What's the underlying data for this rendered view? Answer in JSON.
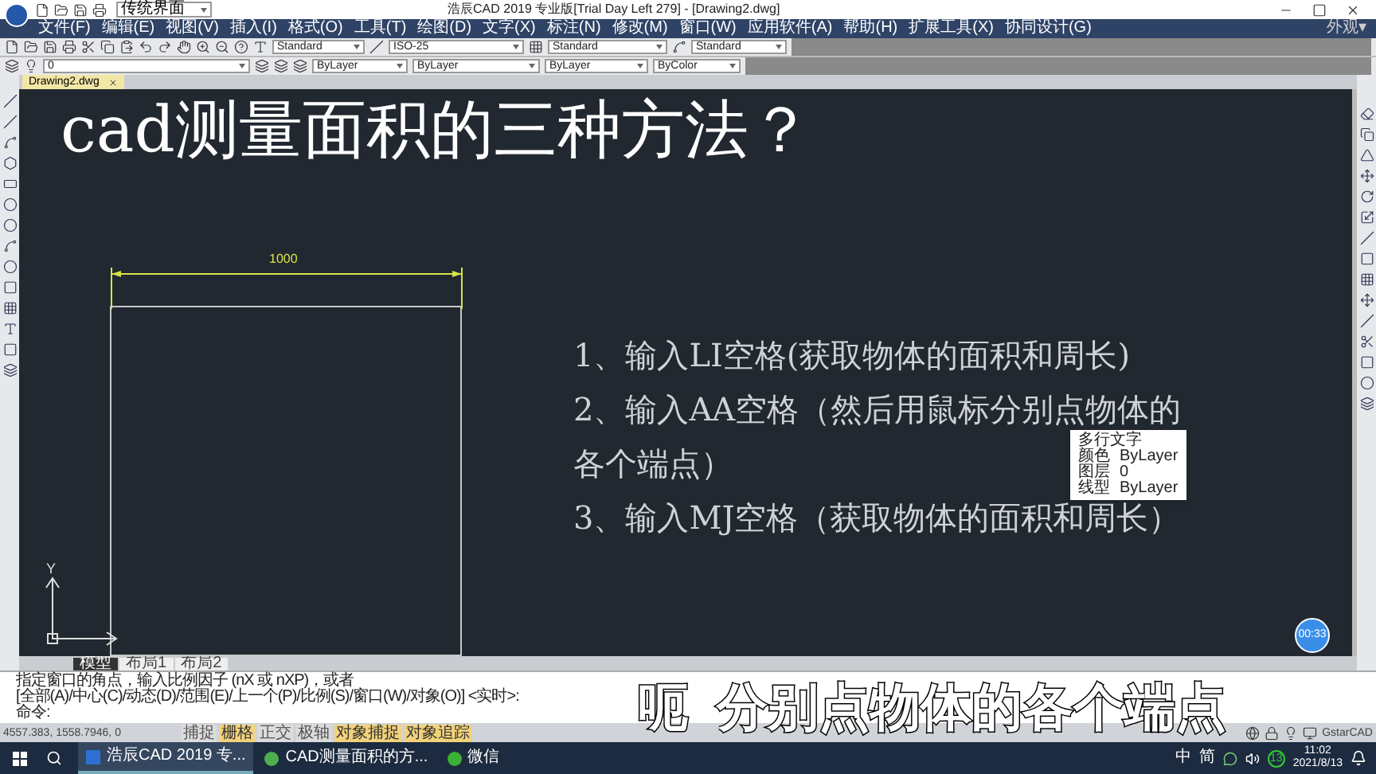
{
  "window": {
    "title": "浩辰CAD 2019 专业版[Trial Day Left 279] - [Drawing2.dwg]",
    "workspace": "传统界面"
  },
  "menu": [
    "文件(F)",
    "编辑(E)",
    "视图(V)",
    "插入(I)",
    "格式(O)",
    "工具(T)",
    "绘图(D)",
    "文字(X)",
    "标注(N)",
    "修改(M)",
    "窗口(W)",
    "应用软件(A)",
    "帮助(H)",
    "扩展工具(X)",
    "协同设计(G)"
  ],
  "appearance": "外观▾",
  "style_dropdowns": [
    "Standard",
    "ISO-25",
    "Standard",
    "Standard"
  ],
  "layer": "0",
  "property_dropdowns": [
    "ByLayer",
    "ByLayer",
    "ByLayer",
    "ByColor"
  ],
  "document_tabs": [
    {
      "label": "Drawing2.dwg",
      "selected": true
    }
  ],
  "drawing": {
    "heading": "cad测量面积的三种方法？",
    "dimension": "1000",
    "axis_label": "Y",
    "notes": [
      "1、输入LI空格(获取物体的面积和周长)",
      "2、输入AA空格（然后用鼠标分别点物体的",
      "各个端点）",
      "3、输入MJ空格（获取物体的面积和周长）"
    ],
    "tooltip": {
      "title": "多行文字",
      "rows": [
        {
          "label": "颜色",
          "value": "ByLayer"
        },
        {
          "label": "图层",
          "value": "0"
        },
        {
          "label": "线型",
          "value": "ByLayer"
        }
      ]
    }
  },
  "layout_tabs": [
    {
      "label": "模型",
      "selected": true
    },
    {
      "label": "布局1",
      "selected": false
    },
    {
      "label": "布局2",
      "selected": false
    }
  ],
  "command_lines": [
    "指定窗口的角点，输入比例因子 (nX 或 nXP)，或者",
    "[全部(A)/中心(C)/动态(D)/范围(E)/上一个(P)/比例(S)/窗口(W)/对象(O)] <实时>:",
    "命令:"
  ],
  "coordinates": "4557.383, 1558.7946, 0",
  "status_toggles": [
    {
      "label": "捕捉",
      "on": false
    },
    {
      "label": "栅格",
      "on": true
    },
    {
      "label": "正交",
      "on": false
    },
    {
      "label": "极轴",
      "on": false
    },
    {
      "label": "对象捕捉",
      "on": true
    },
    {
      "label": "对象追踪",
      "on": true
    }
  ],
  "brand": "GstarCAD",
  "subtitle": "呃  分别点物体的各个端点",
  "timer": "00:33",
  "taskbar": {
    "items": [
      {
        "label": "浩辰CAD 2019 专...",
        "selected": true,
        "kind": "cad"
      },
      {
        "label": "CAD测量面积的方...",
        "selected": false,
        "kind": "browser"
      },
      {
        "label": "微信",
        "selected": false,
        "kind": "chat"
      }
    ],
    "tray": [
      "中",
      "简"
    ],
    "badge": "13",
    "time": "11:02",
    "date": "2021/8/13"
  }
}
